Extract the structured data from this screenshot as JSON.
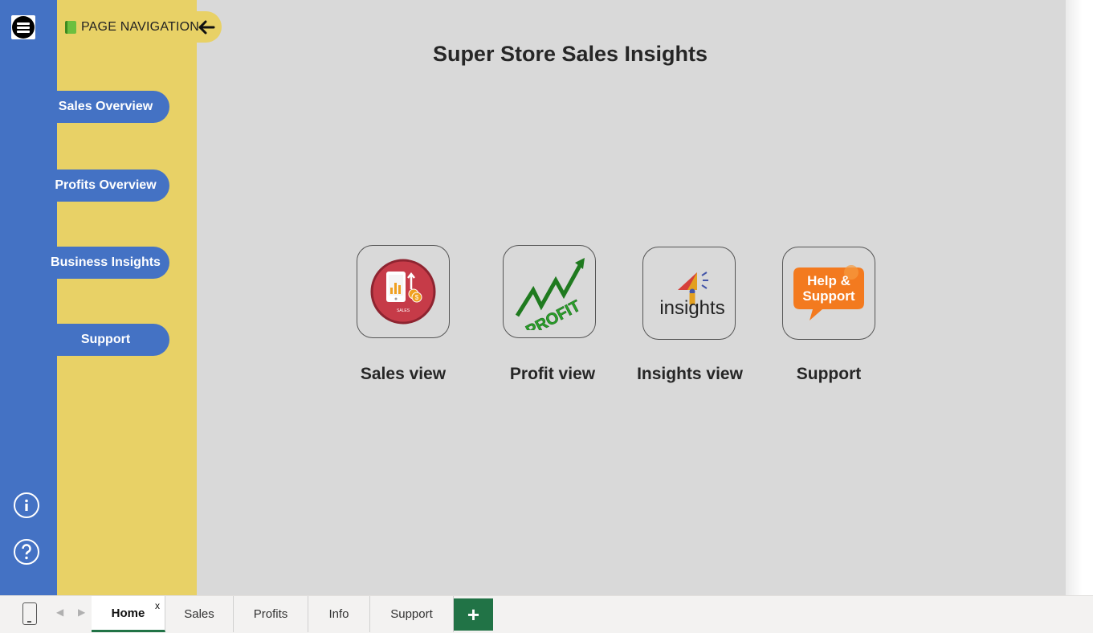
{
  "nav": {
    "header": "PAGE NAVIGATION",
    "items": [
      {
        "label": "Sales Overview"
      },
      {
        "label": "Profits Overview"
      },
      {
        "label": "Business Insights"
      },
      {
        "label": "Support"
      }
    ]
  },
  "rail": {
    "menu_icon": "hamburger-icon",
    "info_icon": "info-icon",
    "help_icon": "help-icon"
  },
  "main": {
    "title": "Super Store Sales Insights",
    "tiles": [
      {
        "label": "Sales view",
        "icon": "sales-icon",
        "icon_text": "SALES"
      },
      {
        "label": "Profit view",
        "icon": "profit-icon",
        "icon_text": "PROFIT"
      },
      {
        "label": "Insights view",
        "icon": "insights-icon",
        "icon_text": "insights"
      },
      {
        "label": "Support",
        "icon": "help-support-icon",
        "icon_text": "Help & Support"
      }
    ]
  },
  "tabs": {
    "items": [
      "Home",
      "Sales",
      "Profits",
      "Info",
      "Support"
    ],
    "active": "Home",
    "close_label": "x",
    "add_label": "+"
  },
  "colors": {
    "rail_blue": "#4472c4",
    "panel_yellow": "#e8d166",
    "canvas_gray": "#d9d9d9",
    "tab_green": "#217346"
  }
}
